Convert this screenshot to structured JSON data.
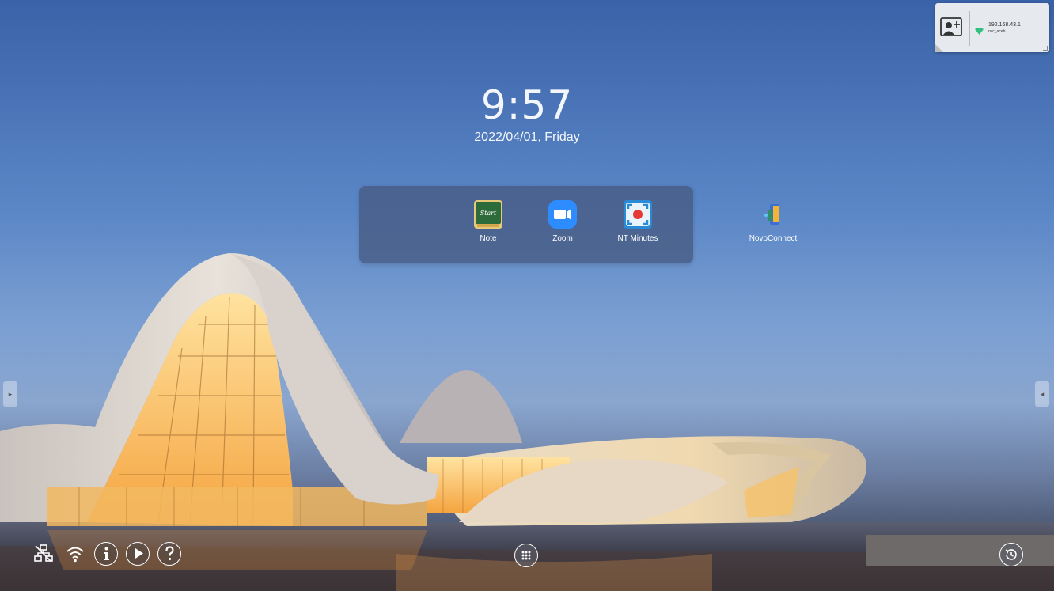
{
  "clock": {
    "time": "9:57",
    "date": "2022/04/01, Friday"
  },
  "dock": {
    "apps": [
      {
        "label": "NovoConnect",
        "icon": "novoconnect-icon"
      },
      {
        "label": "Note",
        "icon": "note-icon",
        "badge": "Start"
      },
      {
        "label": "Zoom",
        "icon": "zoom-icon"
      },
      {
        "label": "NT Minutes",
        "icon": "nt-minutes-icon"
      }
    ]
  },
  "connection": {
    "ip": "192.168.43.1",
    "ssid": "nvc_aceb"
  },
  "toolbar": {
    "left_icons": [
      "network-off-icon",
      "wifi-icon",
      "info-icon",
      "play-icon",
      "help-icon"
    ],
    "center_icon": "apps-grid-icon",
    "right_icon": "history-icon"
  },
  "colors": {
    "dock_bg": "#465a82",
    "zoom_blue": "#2d8cff",
    "note_green": "#2e6b3a",
    "nt_red": "#e53935",
    "wifi_green": "#2ec27e"
  }
}
